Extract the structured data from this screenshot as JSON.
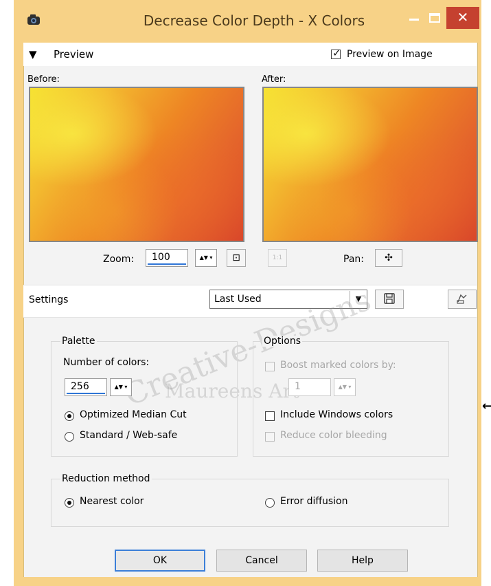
{
  "window": {
    "title": "Decrease Color Depth - X Colors",
    "controls": {
      "minimize": "–",
      "maximize": "□",
      "close": "✕"
    }
  },
  "preview": {
    "toggle_icon": "▼",
    "section_label": "Preview",
    "preview_on_image_label": "Preview on Image",
    "preview_on_image_checked": true,
    "before_label": "Before:",
    "after_label": "After:",
    "zoom_label": "Zoom:",
    "zoom_value": "100",
    "pan_label": "Pan:",
    "fit_icon": "⊡",
    "actual_size_label": "1:1",
    "pan_icon": "✣"
  },
  "settings": {
    "label": "Settings",
    "preset_value": "Last Used",
    "save_icon": "floppy-disk-icon",
    "resource_icon": "resource-manager-icon"
  },
  "palette": {
    "title": "Palette",
    "number_of_colors_label": "Number of colors:",
    "number_of_colors_value": "256",
    "radio_options": [
      {
        "label": "Optimized Median Cut",
        "selected": true
      },
      {
        "label": "Standard / Web-safe",
        "selected": false
      }
    ]
  },
  "options": {
    "title": "Options",
    "boost_label": "Boost marked colors by:",
    "boost_checked": false,
    "boost_value": "1",
    "include_windows_label": "Include Windows colors",
    "include_windows_checked": false,
    "reduce_bleeding_label": "Reduce color bleeding",
    "reduce_bleeding_checked": false
  },
  "reduction": {
    "title": "Reduction method",
    "radio_options": [
      {
        "label": "Nearest color",
        "selected": true
      },
      {
        "label": "Error diffusion",
        "selected": false
      }
    ]
  },
  "buttons": {
    "ok": "OK",
    "cancel": "Cancel",
    "help": "Help"
  },
  "watermark": {
    "line1": "Creative-Designs",
    "line2": "Maureens Art"
  },
  "colors": {
    "title_bar": "#f7d287",
    "close_button": "#c5412f",
    "focus_border": "#3c7fd8"
  }
}
